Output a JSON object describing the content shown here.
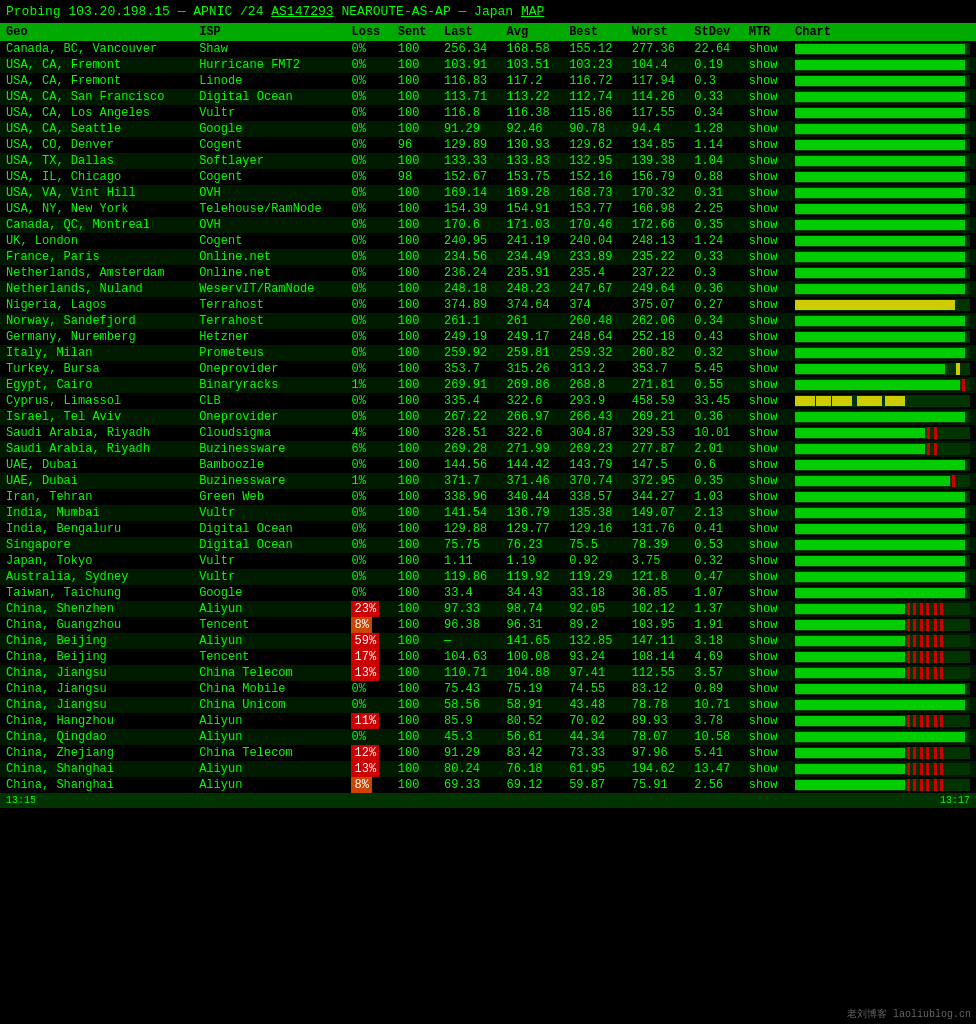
{
  "header": {
    "title": "Probing 103.20.198.15 — APNIC /24",
    "link_text": "AS147293",
    "link_suffix": " NEAROUTE-AS-AP — Japan",
    "map_link": "MAP"
  },
  "columns": [
    "Geo",
    "ISP",
    "Loss",
    "Sent",
    "Last",
    "Avg",
    "Best",
    "Worst",
    "StDev",
    "MTR",
    "Chart"
  ],
  "rows": [
    {
      "geo": "Canada, BC, Vancouver",
      "isp": "Shaw",
      "loss": "0%",
      "loss_class": "normal",
      "sent": "100",
      "last": "256.34",
      "avg": "168.58",
      "best": "155.12",
      "worst": "277.36",
      "stdev": "22.64",
      "chart_type": "green"
    },
    {
      "geo": "USA, CA, Fremont",
      "isp": "Hurricane FMT2",
      "loss": "0%",
      "loss_class": "normal",
      "sent": "100",
      "last": "103.91",
      "avg": "103.51",
      "best": "103.23",
      "worst": "104.4",
      "stdev": "0.19",
      "chart_type": "green"
    },
    {
      "geo": "USA, CA, Fremont",
      "isp": "Linode",
      "loss": "0%",
      "loss_class": "normal",
      "sent": "100",
      "last": "116.83",
      "avg": "117.2",
      "best": "116.72",
      "worst": "117.94",
      "stdev": "0.3",
      "chart_type": "green"
    },
    {
      "geo": "USA, CA, San Francisco",
      "isp": "Digital Ocean",
      "loss": "0%",
      "loss_class": "normal",
      "sent": "100",
      "last": "113.71",
      "avg": "113.22",
      "best": "112.74",
      "worst": "114.26",
      "stdev": "0.33",
      "chart_type": "green"
    },
    {
      "geo": "USA, CA, Los Angeles",
      "isp": "Vultr",
      "loss": "0%",
      "loss_class": "normal",
      "sent": "100",
      "last": "116.8",
      "avg": "116.38",
      "best": "115.86",
      "worst": "117.55",
      "stdev": "0.34",
      "chart_type": "green"
    },
    {
      "geo": "USA, CA, Seattle",
      "isp": "Google",
      "loss": "0%",
      "loss_class": "normal",
      "sent": "100",
      "last": "91.29",
      "avg": "92.46",
      "best": "90.78",
      "worst": "94.4",
      "stdev": "1.28",
      "chart_type": "green"
    },
    {
      "geo": "USA, CO, Denver",
      "isp": "Cogent",
      "loss": "0%",
      "loss_class": "normal",
      "sent": "96",
      "last": "129.89",
      "avg": "130.93",
      "best": "129.62",
      "worst": "134.85",
      "stdev": "1.14",
      "chart_type": "green"
    },
    {
      "geo": "USA, TX, Dallas",
      "isp": "Softlayer",
      "loss": "0%",
      "loss_class": "normal",
      "sent": "100",
      "last": "133.33",
      "avg": "133.83",
      "best": "132.95",
      "worst": "139.38",
      "stdev": "1.04",
      "chart_type": "green"
    },
    {
      "geo": "USA, IL, Chicago",
      "isp": "Cogent",
      "loss": "0%",
      "loss_class": "normal",
      "sent": "98",
      "last": "152.67",
      "avg": "153.75",
      "best": "152.16",
      "worst": "156.79",
      "stdev": "0.88",
      "chart_type": "green"
    },
    {
      "geo": "USA, VA, Vint Hill",
      "isp": "OVH",
      "loss": "0%",
      "loss_class": "normal",
      "sent": "100",
      "last": "169.14",
      "avg": "169.28",
      "best": "168.73",
      "worst": "170.32",
      "stdev": "0.31",
      "chart_type": "green"
    },
    {
      "geo": "USA, NY, New York",
      "isp": "Telehouse/RamNode",
      "loss": "0%",
      "loss_class": "normal",
      "sent": "100",
      "last": "154.39",
      "avg": "154.91",
      "best": "153.77",
      "worst": "166.98",
      "stdev": "2.25",
      "chart_type": "green"
    },
    {
      "geo": "Canada, QC, Montreal",
      "isp": "OVH",
      "loss": "0%",
      "loss_class": "normal",
      "sent": "100",
      "last": "170.6",
      "avg": "171.03",
      "best": "170.46",
      "worst": "172.66",
      "stdev": "0.35",
      "chart_type": "green"
    },
    {
      "geo": "UK, London",
      "isp": "Cogent",
      "loss": "0%",
      "loss_class": "normal",
      "sent": "100",
      "last": "240.95",
      "avg": "241.19",
      "best": "240.04",
      "worst": "248.13",
      "stdev": "1.24",
      "chart_type": "green"
    },
    {
      "geo": "France, Paris",
      "isp": "Online.net",
      "loss": "0%",
      "loss_class": "normal",
      "sent": "100",
      "last": "234.56",
      "avg": "234.49",
      "best": "233.89",
      "worst": "235.22",
      "stdev": "0.33",
      "chart_type": "green"
    },
    {
      "geo": "Netherlands, Amsterdam",
      "isp": "Online.net",
      "loss": "0%",
      "loss_class": "normal",
      "sent": "100",
      "last": "236.24",
      "avg": "235.91",
      "best": "235.4",
      "worst": "237.22",
      "stdev": "0.3",
      "chart_type": "green"
    },
    {
      "geo": "Netherlands, Nuland",
      "isp": "WeservIT/RamNode",
      "loss": "0%",
      "loss_class": "normal",
      "sent": "100",
      "last": "248.18",
      "avg": "248.23",
      "best": "247.67",
      "worst": "249.64",
      "stdev": "0.36",
      "chart_type": "green"
    },
    {
      "geo": "Nigeria, Lagos",
      "isp": "Terrahost",
      "loss": "0%",
      "loss_class": "normal",
      "sent": "100",
      "last": "374.89",
      "avg": "374.64",
      "best": "374",
      "worst": "375.07",
      "stdev": "0.27",
      "chart_type": "yellow"
    },
    {
      "geo": "Norway, Sandefjord",
      "isp": "Terrahost",
      "loss": "0%",
      "loss_class": "normal",
      "sent": "100",
      "last": "261.1",
      "avg": "261",
      "best": "260.48",
      "worst": "262.06",
      "stdev": "0.34",
      "chart_type": "green"
    },
    {
      "geo": "Germany, Nuremberg",
      "isp": "Hetzner",
      "loss": "0%",
      "loss_class": "normal",
      "sent": "100",
      "last": "249.19",
      "avg": "249.17",
      "best": "248.64",
      "worst": "252.18",
      "stdev": "0.43",
      "chart_type": "green"
    },
    {
      "geo": "Italy, Milan",
      "isp": "Prometeus",
      "loss": "0%",
      "loss_class": "normal",
      "sent": "100",
      "last": "259.92",
      "avg": "259.81",
      "best": "259.32",
      "worst": "260.82",
      "stdev": "0.32",
      "chart_type": "green"
    },
    {
      "geo": "Turkey, Bursa",
      "isp": "Oneprovider",
      "loss": "0%",
      "loss_class": "normal",
      "sent": "100",
      "last": "353.7",
      "avg": "315.26",
      "best": "313.2",
      "worst": "353.7",
      "stdev": "5.45",
      "chart_type": "green_spike"
    },
    {
      "geo": "Egypt, Cairo",
      "isp": "Binaryracks",
      "loss": "1%",
      "loss_class": "normal",
      "sent": "100",
      "last": "269.91",
      "avg": "269.86",
      "best": "268.8",
      "worst": "271.81",
      "stdev": "0.55",
      "chart_type": "green_red_spike"
    },
    {
      "geo": "Cyprus, Limassol",
      "isp": "CLB",
      "loss": "0%",
      "loss_class": "normal",
      "sent": "100",
      "last": "335.4",
      "avg": "322.6",
      "best": "293.9",
      "worst": "458.59",
      "stdev": "33.45",
      "chart_type": "yellow_mixed"
    },
    {
      "geo": "Israel, Tel Aviv",
      "isp": "Oneprovider",
      "loss": "0%",
      "loss_class": "normal",
      "sent": "100",
      "last": "267.22",
      "avg": "266.97",
      "best": "266.43",
      "worst": "269.21",
      "stdev": "0.36",
      "chart_type": "green"
    },
    {
      "geo": "Saudi Arabia, Riyadh",
      "isp": "Cloudsigma",
      "loss": "4%",
      "loss_class": "normal",
      "sent": "100",
      "last": "328.51",
      "avg": "322.6",
      "best": "304.87",
      "worst": "329.53",
      "stdev": "10.01",
      "chart_type": "green_red"
    },
    {
      "geo": "Saudi Arabia, Riyadh",
      "isp": "Buzinessware",
      "loss": "6%",
      "loss_class": "normal",
      "sent": "100",
      "last": "269.28",
      "avg": "271.99",
      "best": "269.23",
      "worst": "277.87",
      "stdev": "2.01",
      "chart_type": "green_red"
    },
    {
      "geo": "UAE, Dubai",
      "isp": "Bamboozle",
      "loss": "0%",
      "loss_class": "normal",
      "sent": "100",
      "last": "144.56",
      "avg": "144.42",
      "best": "143.79",
      "worst": "147.5",
      "stdev": "0.6",
      "chart_type": "green"
    },
    {
      "geo": "UAE, Dubai",
      "isp": "Buzinessware",
      "loss": "1%",
      "loss_class": "normal",
      "sent": "100",
      "last": "371.7",
      "avg": "371.46",
      "best": "370.74",
      "worst": "372.95",
      "stdev": "0.35",
      "chart_type": "green_red_small"
    },
    {
      "geo": "Iran, Tehran",
      "isp": "Green Web",
      "loss": "0%",
      "loss_class": "normal",
      "sent": "100",
      "last": "338.96",
      "avg": "340.44",
      "best": "338.57",
      "worst": "344.27",
      "stdev": "1.03",
      "chart_type": "green"
    },
    {
      "geo": "India, Mumbai",
      "isp": "Vultr",
      "loss": "0%",
      "loss_class": "normal",
      "sent": "100",
      "last": "141.54",
      "avg": "136.79",
      "best": "135.38",
      "worst": "149.07",
      "stdev": "2.13",
      "chart_type": "green"
    },
    {
      "geo": "India, Bengaluru",
      "isp": "Digital Ocean",
      "loss": "0%",
      "loss_class": "normal",
      "sent": "100",
      "last": "129.88",
      "avg": "129.77",
      "best": "129.16",
      "worst": "131.76",
      "stdev": "0.41",
      "chart_type": "green"
    },
    {
      "geo": "Singapore",
      "isp": "Digital Ocean",
      "loss": "0%",
      "loss_class": "normal",
      "sent": "100",
      "last": "75.75",
      "avg": "76.23",
      "best": "75.5",
      "worst": "78.39",
      "stdev": "0.53",
      "chart_type": "green"
    },
    {
      "geo": "Japan, Tokyo",
      "isp": "Vultr",
      "loss": "0%",
      "loss_class": "normal",
      "sent": "100",
      "last": "1.11",
      "avg": "1.19",
      "best": "0.92",
      "worst": "3.75",
      "stdev": "0.32",
      "chart_type": "green"
    },
    {
      "geo": "Australia, Sydney",
      "isp": "Vultr",
      "loss": "0%",
      "loss_class": "normal",
      "sent": "100",
      "last": "119.86",
      "avg": "119.92",
      "best": "119.29",
      "worst": "121.8",
      "stdev": "0.47",
      "chart_type": "green"
    },
    {
      "geo": "Taiwan, Taichung",
      "isp": "Google",
      "loss": "0%",
      "loss_class": "normal",
      "sent": "100",
      "last": "33.4",
      "avg": "34.43",
      "best": "33.18",
      "worst": "36.85",
      "stdev": "1.07",
      "chart_type": "green"
    },
    {
      "geo": "China, Shenzhen",
      "isp": "Aliyun",
      "loss": "23%",
      "loss_class": "high",
      "sent": "100",
      "last": "97.33",
      "avg": "98.74",
      "best": "92.05",
      "worst": "102.12",
      "stdev": "1.37",
      "chart_type": "green_red_many"
    },
    {
      "geo": "China, Guangzhou",
      "isp": "Tencent",
      "loss": "8%",
      "loss_class": "medium",
      "sent": "100",
      "last": "96.38",
      "avg": "96.31",
      "best": "89.2",
      "worst": "103.95",
      "stdev": "1.91",
      "chart_type": "green_red_many"
    },
    {
      "geo": "China, Beijing",
      "isp": "Aliyun",
      "loss": "59%",
      "loss_class": "high",
      "sent": "100",
      "last": "—",
      "avg": "141.65",
      "best": "132.85",
      "worst": "147.11",
      "stdev": "3.18",
      "chart_type": "green_red_many"
    },
    {
      "geo": "China, Beijing",
      "isp": "Tencent",
      "loss": "17%",
      "loss_class": "high",
      "sent": "100",
      "last": "104.63",
      "avg": "100.08",
      "best": "93.24",
      "worst": "108.14",
      "stdev": "4.69",
      "chart_type": "green_red_many"
    },
    {
      "geo": "China, Jiangsu",
      "isp": "China Telecom",
      "loss": "13%",
      "loss_class": "high",
      "sent": "100",
      "last": "110.71",
      "avg": "104.88",
      "best": "97.41",
      "worst": "112.55",
      "stdev": "3.57",
      "chart_type": "green_red_many"
    },
    {
      "geo": "China, Jiangsu",
      "isp": "China Mobile",
      "loss": "0%",
      "loss_class": "normal",
      "sent": "100",
      "last": "75.43",
      "avg": "75.19",
      "best": "74.55",
      "worst": "83.12",
      "stdev": "0.89",
      "chart_type": "green"
    },
    {
      "geo": "China, Jiangsu",
      "isp": "China Unicom",
      "loss": "0%",
      "loss_class": "normal",
      "sent": "100",
      "last": "58.56",
      "avg": "58.91",
      "best": "43.48",
      "worst": "78.78",
      "stdev": "10.71",
      "chart_type": "green"
    },
    {
      "geo": "China, Hangzhou",
      "isp": "Aliyun",
      "loss": "11%",
      "loss_class": "high",
      "sent": "100",
      "last": "85.9",
      "avg": "80.52",
      "best": "70.02",
      "worst": "89.93",
      "stdev": "3.78",
      "chart_type": "green_red_many"
    },
    {
      "geo": "China, Qingdao",
      "isp": "Aliyun",
      "loss": "0%",
      "loss_class": "normal",
      "sent": "100",
      "last": "45.3",
      "avg": "56.61",
      "best": "44.34",
      "worst": "78.07",
      "stdev": "10.58",
      "chart_type": "green"
    },
    {
      "geo": "China, Zhejiang",
      "isp": "China Telecom",
      "loss": "12%",
      "loss_class": "high",
      "sent": "100",
      "last": "91.29",
      "avg": "83.42",
      "best": "73.33",
      "worst": "97.96",
      "stdev": "5.41",
      "chart_type": "green_red_many"
    },
    {
      "geo": "China, Shanghai",
      "isp": "Aliyun",
      "loss": "13%",
      "loss_class": "high",
      "sent": "100",
      "last": "80.24",
      "avg": "76.18",
      "best": "61.95",
      "worst": "194.62",
      "stdev": "13.47",
      "chart_type": "green_red_many"
    },
    {
      "geo": "China, Shanghai",
      "isp": "Aliyun",
      "loss": "8%",
      "loss_class": "medium",
      "sent": "100",
      "last": "69.33",
      "avg": "69.12",
      "best": "59.87",
      "worst": "75.91",
      "stdev": "2.56",
      "chart_type": "green_red_many"
    }
  ],
  "footer": {
    "left": "13:15",
    "right": "13:17"
  },
  "watermark": "老刘博客 laoliublog.cn"
}
